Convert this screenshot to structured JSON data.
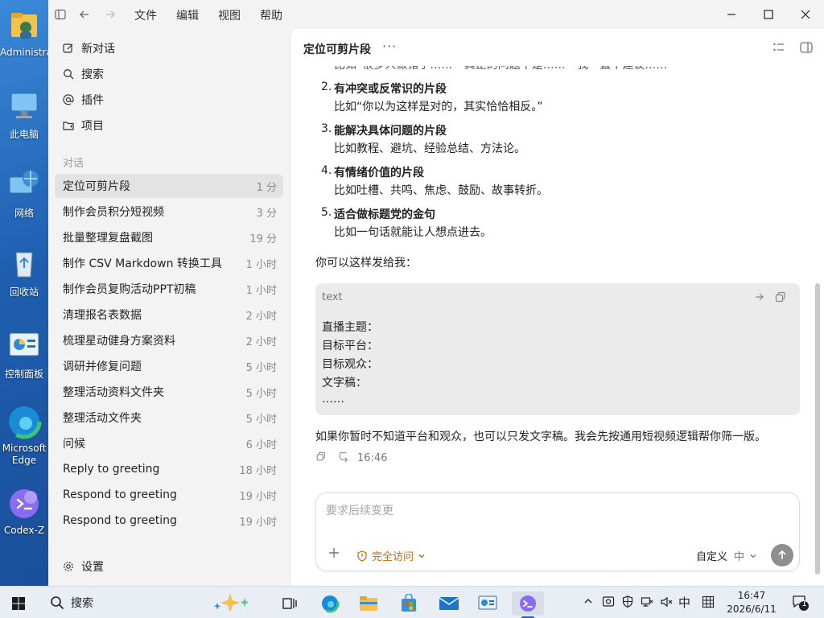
{
  "desktop": {
    "icons": [
      {
        "label": "Administrator"
      },
      {
        "label": "此电脑"
      },
      {
        "label": "网络"
      },
      {
        "label": "回收站"
      },
      {
        "label": "控制面板"
      },
      {
        "label": "Microsoft Edge"
      },
      {
        "label": "Codex-Z"
      }
    ]
  },
  "titlebar": {
    "menu": [
      "文件",
      "编辑",
      "视图",
      "帮助"
    ]
  },
  "sidebar": {
    "nav": [
      {
        "label": "新对话",
        "icon": "edit-icon"
      },
      {
        "label": "搜索",
        "icon": "search-icon"
      },
      {
        "label": "插件",
        "icon": "at-icon"
      },
      {
        "label": "项目",
        "icon": "folder-icon"
      }
    ],
    "section_label": "对话",
    "conversations": [
      {
        "title": "定位可剪片段",
        "time": "1 分",
        "active": true
      },
      {
        "title": "制作会员积分短视频",
        "time": "3 分"
      },
      {
        "title": "批量整理复盘截图",
        "time": "19 分"
      },
      {
        "title": "制作 CSV Markdown 转换工具",
        "time": "1 小时"
      },
      {
        "title": "制作会员复购活动PPT初稿",
        "time": "1 小时"
      },
      {
        "title": "清理报名表数据",
        "time": "2 小时"
      },
      {
        "title": "梳理星动健身方案资料",
        "time": "2 小时"
      },
      {
        "title": "调研并修复问题",
        "time": "5 小时"
      },
      {
        "title": "整理活动资料文件夹",
        "time": "5 小时"
      },
      {
        "title": "整理活动文件夹",
        "time": "5 小时"
      },
      {
        "title": "问候",
        "time": "6 小时"
      },
      {
        "title": "Reply to greeting",
        "time": "18 小时"
      },
      {
        "title": "Respond to greeting",
        "time": "19 小时"
      },
      {
        "title": "Respond to greeting",
        "time": "19 小时"
      }
    ],
    "settings_label": "设置"
  },
  "main": {
    "title": "定位可剪片段",
    "more": "···",
    "cut_line": "比如“很多人做错了……”“真正的问题不是……”“我一直不建议……”",
    "list": [
      {
        "num": "2.",
        "title": "有冲突或反常识的片段",
        "desc": "比如“你以为这样是对的，其实恰恰相反。”"
      },
      {
        "num": "3.",
        "title": "能解决具体问题的片段",
        "desc": "比如教程、避坑、经验总结、方法论。"
      },
      {
        "num": "4.",
        "title": "有情绪价值的片段",
        "desc": "比如吐槽、共鸣、焦虑、鼓励、故事转折。"
      },
      {
        "num": "5.",
        "title": "适合做标题党的金句",
        "desc": "比如一句话就能让人想点进去。"
      }
    ],
    "intro": "你可以这样发给我：",
    "code": {
      "lang": "text",
      "lines": [
        "直播主题：",
        "目标平台：",
        "目标观众：",
        "文字稿：",
        "……"
      ]
    },
    "closing": "如果你暂时不知道平台和观众，也可以只发文字稿。我会先按通用短视频逻辑帮你筛一版。",
    "msg_time": "16:46",
    "composer": {
      "placeholder": "要求后续变更",
      "access_label": "完全访问",
      "model_label": "自定义",
      "model_level": "中"
    }
  },
  "taskbar": {
    "search_label": "搜索",
    "tray_lang": "中",
    "time": "16:47",
    "date": "2026/6/11",
    "notification_count": "1"
  },
  "colors": {
    "accent_orange": "#c26a10",
    "sidebar_bg": "#f3f3f3",
    "active_item": "#e3e3e3",
    "code_bg": "#ebebeb"
  }
}
